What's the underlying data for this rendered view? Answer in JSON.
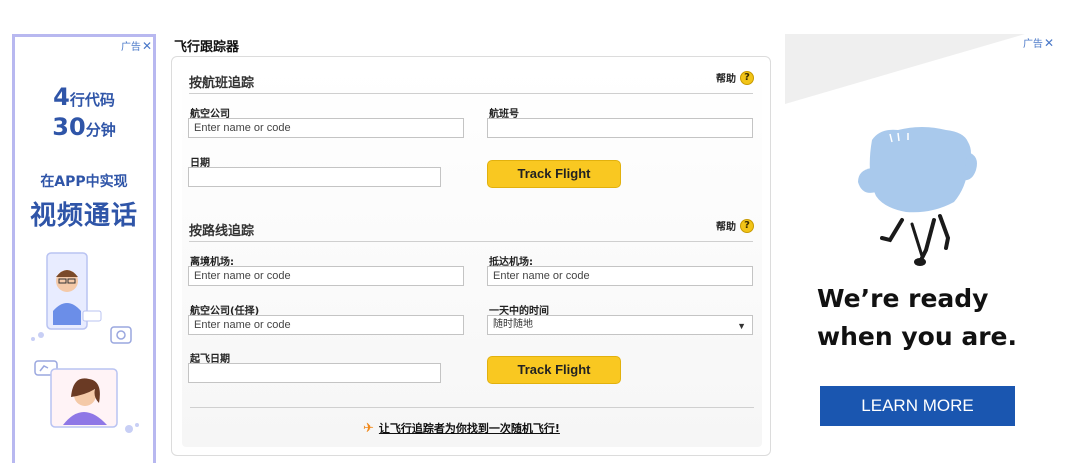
{
  "left_ad": {
    "ad_label": "广告",
    "close": "✕",
    "line1_big": "4",
    "line1_small": "行代码",
    "line2_big": "30",
    "line2_small": "分钟",
    "line3": "在APP中实现",
    "line4": "视频通话"
  },
  "tracker": {
    "title": "飞行跟踪器",
    "by_flight": {
      "title": "按航班追踪",
      "help": "帮助",
      "airline_label": "航空公司",
      "airline_placeholder": "Enter name or code",
      "flight_no_label": "航班号",
      "flight_no_value": "",
      "date_label": "日期",
      "date_value": "",
      "button": "Track Flight"
    },
    "by_route": {
      "title": "按路线追踪",
      "help": "帮助",
      "depart_label": "离境机场:",
      "depart_placeholder": "Enter name or code",
      "arrive_label": "抵达机场:",
      "arrive_placeholder": "Enter name or code",
      "airline_label": "航空公司(任择)",
      "airline_placeholder": "Enter name or code",
      "time_label": "一天中的时间",
      "time_value": "随时随地",
      "depart_date_label": "起飞日期",
      "depart_date_value": "",
      "button": "Track Flight"
    },
    "random_link": "让飞行追踪者为你找到一次随机飞行!"
  },
  "right_ad": {
    "ad_label": "广告",
    "close": "✕",
    "headline_line1": "We’re ready",
    "headline_line2": "when you are.",
    "button": "LEARN MORE",
    "colors": {
      "button": "#1a56b0",
      "art": "#a9c9ec"
    }
  }
}
